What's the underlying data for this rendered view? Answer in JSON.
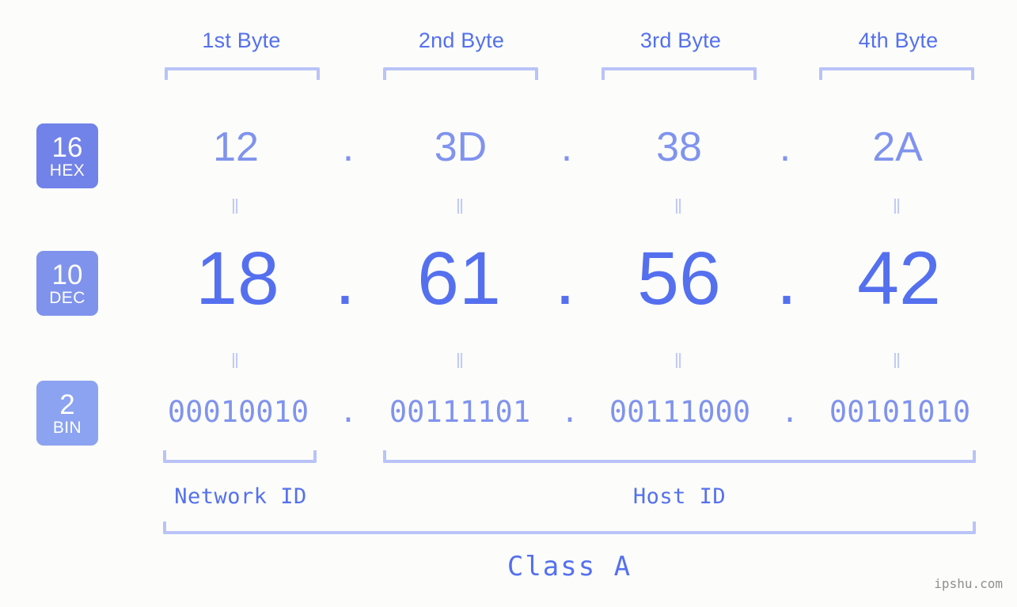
{
  "watermark": "ipshu.com",
  "byte_headers": [
    {
      "label": "1st Byte"
    },
    {
      "label": "2nd Byte"
    },
    {
      "label": "3rd Byte"
    },
    {
      "label": "4th Byte"
    }
  ],
  "radix_badges": [
    {
      "number": "16",
      "name": "HEX",
      "color": "#7182e8"
    },
    {
      "number": "10",
      "name": "DEC",
      "color": "#7f93ec"
    },
    {
      "number": "2",
      "name": "BIN",
      "color": "#8ba3f0"
    }
  ],
  "rows": {
    "hex": {
      "values": [
        "12",
        "3D",
        "38",
        "2A"
      ],
      "separator": ".",
      "color": "#8093ee"
    },
    "dec": {
      "values": [
        "18",
        "61",
        "56",
        "42"
      ],
      "separator": ".",
      "color": "#5570ee"
    },
    "bin": {
      "values": [
        "00010010",
        "00111101",
        "00111000",
        "00101010"
      ],
      "separator": ".",
      "color": "#8093ee"
    }
  },
  "equals_marks": {
    "glyph": "‖",
    "color": "#c3cbf8"
  },
  "sections": [
    {
      "label": "Network ID"
    },
    {
      "label": "Host ID"
    }
  ],
  "ip_class": {
    "label": "Class A"
  },
  "colors": {
    "background": "#fcfdfa",
    "accent_strong": "#5570ee",
    "accent_mid": "#8093ee",
    "accent_light": "#b9c3f8"
  }
}
